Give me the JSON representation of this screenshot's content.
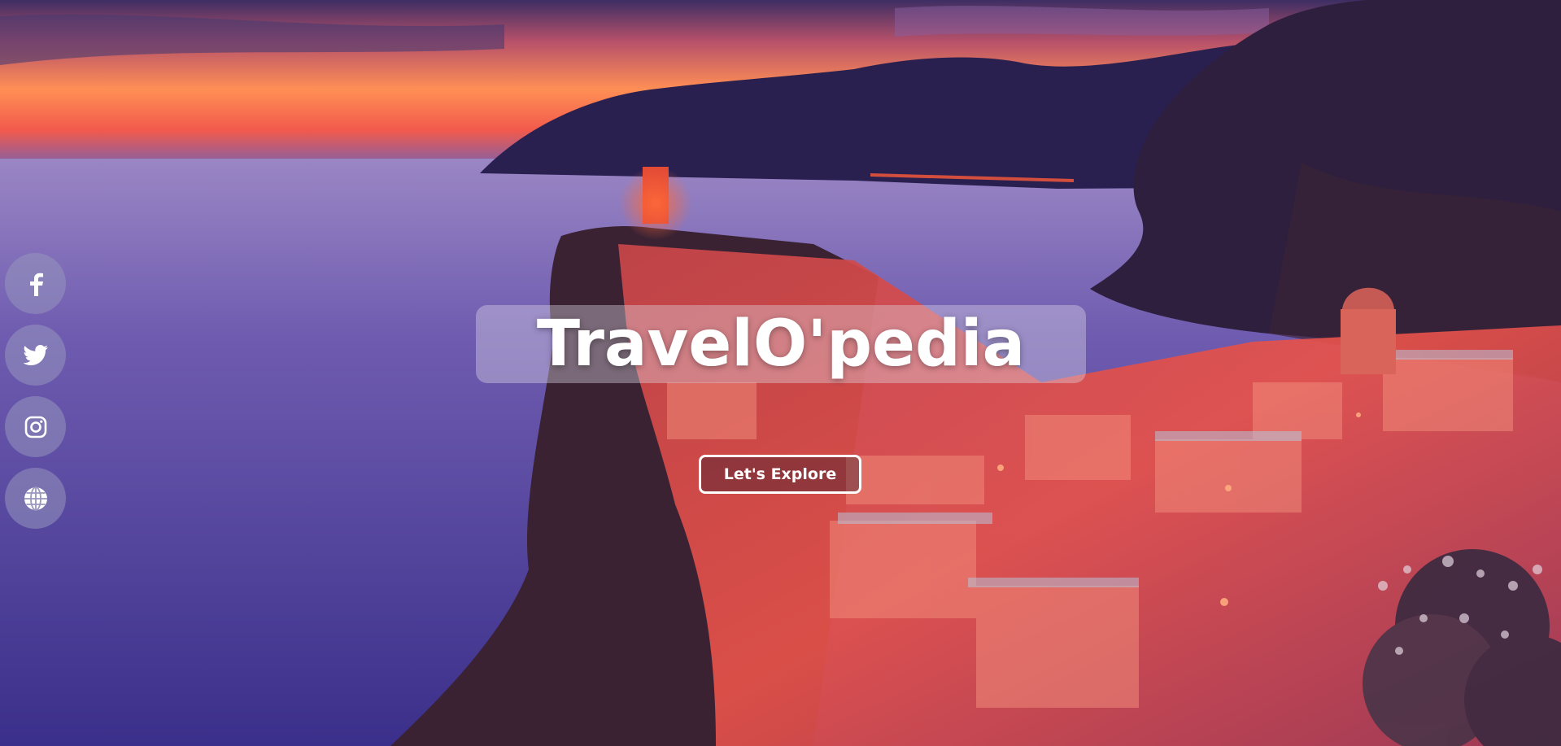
{
  "hero": {
    "title": "TravelO'pedia",
    "cta_label": "Let's Explore"
  },
  "social": [
    {
      "icon": "facebook-icon"
    },
    {
      "icon": "twitter-icon"
    },
    {
      "icon": "instagram-icon"
    },
    {
      "icon": "globe-icon"
    }
  ],
  "colors": {
    "sky_top": "#3a2a5c",
    "sunset_orange": "#ff7a45",
    "sea_purple": "#5b4aa0",
    "mountain_dark": "#1e1740",
    "town_red": "#e0483a",
    "accent_white": "#ffffff"
  }
}
